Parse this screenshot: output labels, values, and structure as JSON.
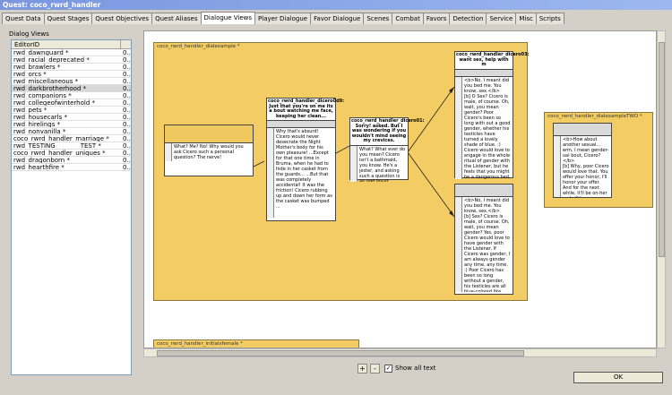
{
  "window": {
    "title": "Quest: coco_rwrd_handler"
  },
  "tabs": [
    "Quest Data",
    "Quest Stages",
    "Quest Objectives",
    "Quest Aliases",
    "Dialogue Views",
    "Player Dialogue",
    "Favor Dialogue",
    "Scenes",
    "Combat",
    "Favors",
    "Detection",
    "Service",
    "Misc",
    "Scripts"
  ],
  "left": {
    "label": "Dialog Views",
    "column_header": "EditorID",
    "rows": [
      [
        "rwd_dawnguard *",
        "0..."
      ],
      [
        "rwd_racial_deprecated *",
        "0..."
      ],
      [
        "rwd_brawlers *",
        "0..."
      ],
      [
        "rwd_orcs *",
        "0..."
      ],
      [
        "rwd_miscellaneous *",
        "0..."
      ],
      [
        "rwd_darkbrotherhood *",
        "0..."
      ],
      [
        "rwd_companions *",
        "0..."
      ],
      [
        "rwd_collegeofwinterhold *",
        "0..."
      ],
      [
        "rwd_pets *",
        "0..."
      ],
      [
        "rwd_housecarls *",
        "0..."
      ],
      [
        "rwd_hirelings *",
        "0..."
      ],
      [
        "rwd_nonvanilla *",
        "0..."
      ],
      [
        "coco_rwrd_handler_marriage *",
        "0..."
      ],
      [
        "rwd_TESTING________TEST *",
        "0..."
      ],
      [
        "coco_rwrd_handler_uniques *",
        "0..."
      ],
      [
        "rwd_dragonborn *",
        "0..."
      ],
      [
        "rwd_hearthfire *",
        "0..."
      ]
    ]
  },
  "views": {
    "main_title": "coco_rwrd_handler_dialexample *",
    "two_title": "coco_rwrd_handler_dialexampleTWO *",
    "bottom_title": "coco_rwrd_handler_initialsfemale *"
  },
  "nodes": {
    "n1_text": "What? Me? No! Why would you ask Cicero such a personal question? The nerve!",
    "n2_head": "coco_rwrd_handler_dicero0d9: Just that you're on me its a bout watching me face, keeping her clean...",
    "n2_text": "Why that's absurd! Cicero would never desecrate the Night Mother's body for his own pleasure! ...Except for that one time in Bruma, when he had to hide in her casket from the guards... ...But that was completely accidental! It was the friction! Cicero rubbing up and down her form as the casket was bumped ...",
    "n3_head": "coco_rwrd_handler_dicero01: Sorry! asked. But I was wondering if you wouldn't mind seeing my crevices.",
    "n3_text": "What? What ever do you mean? Cicero isn't a bathmaid, you know. He's a jester, and asking such a question is an odd insult indeed!",
    "n4_head": "coco_rwrd_handler_dicero03: want sex, help with m",
    "n4_text1": "<b>No, I meant did you bed me. You know, sex.</b>",
    "n4_text2": "[b] O Sex? Cicero is male, of course. Oh, wait, you mean gender? Poor Cicero's been so long with out a good gender, whether his testicles have turned a lovely shade of blue. :) Cicero would love to engage in the whole ritual of gender with the Listener, but he feels that you might be a dangerous bed. :) ...still, you did belong to the guards a little while.",
    "n5_text1": "<b>No, I meant did you bed me. You know, sex.</b>",
    "n5_text2": "[b] Sex? Cicero is male, of course. Oh, wait, you mean gender? Yes, poor Cicero would love to have gender with the Listener. If Cicero was gender, I am always gender any time, any time. :) Poor Cicero has been so long without a gender, his testicles are all blue-colored like, take a look!",
    "n6_text1": "<b>How about another sexual... erm, I mean gender-ual bout, Cicero?</b>",
    "n6_text2": "[b] Why, poor Cicero would love that. You offer your honor, I'll honor your offer. And for the next while, it'll be on-her and off-her..."
  },
  "bottom": {
    "zoom_in": "+",
    "zoom_out": "-",
    "show_all_text": "Show all text",
    "ok": "OK"
  },
  "colors": {
    "view_fill": "#f3cd64",
    "active_tab": "#ffffff",
    "title_bar": "#7a96df"
  }
}
